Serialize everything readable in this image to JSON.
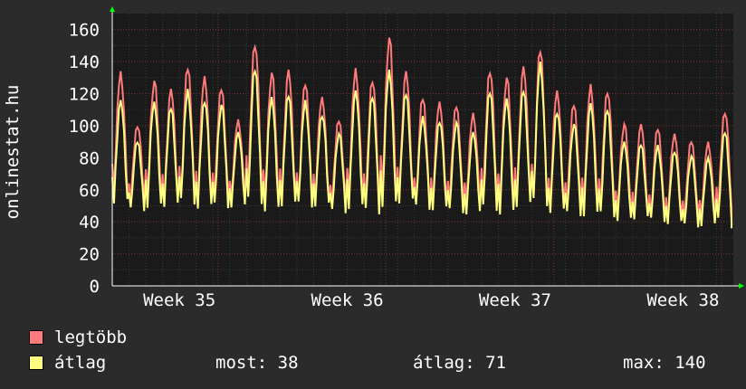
{
  "chart_data": {
    "type": "line",
    "ylabel": "onlinestat.hu",
    "ylim": [
      0,
      170
    ],
    "y_ticks": [
      "0",
      "20",
      "40",
      "60",
      "80",
      "100",
      "120",
      "140",
      "160"
    ],
    "y_tick_values": [
      0,
      20,
      40,
      60,
      80,
      100,
      120,
      140,
      160
    ],
    "x_tick_labels": [
      "Week 35",
      "Week 36",
      "Week 37",
      "Week 38"
    ],
    "x_range_days": 31,
    "x_tick_positions_days": [
      9.5,
      19.5,
      29.5,
      39.5
    ],
    "grid": true,
    "series": [
      {
        "name": "legtöbb",
        "color": "#ff7a7a",
        "daily_peaks": [
          134,
          101,
          128,
          123,
          136,
          131,
          124,
          104,
          153,
          133,
          135,
          126,
          118,
          104,
          136,
          130,
          155,
          134,
          117,
          115,
          113,
          108,
          136,
          130,
          137,
          147,
          122,
          114,
          126,
          123,
          101,
          101,
          98,
          95,
          91,
          90,
          110
        ],
        "daily_troughs": [
          45,
          44,
          43,
          41,
          42,
          40,
          42,
          45,
          43,
          40,
          40,
          41,
          44,
          41,
          40,
          38,
          42,
          42,
          41,
          42,
          40,
          41,
          40,
          38,
          40,
          38,
          38,
          38,
          36,
          37,
          37,
          36,
          35,
          34,
          33,
          34,
          36
        ]
      },
      {
        "name": "átlag",
        "color": "#ffff80",
        "daily_peaks": [
          116,
          90,
          115,
          112,
          123,
          117,
          113,
          96,
          135,
          118,
          120,
          116,
          108,
          95,
          122,
          118,
          135,
          121,
          106,
          104,
          102,
          96,
          121,
          117,
          123,
          140,
          110,
          101,
          114,
          110,
          90,
          89,
          88,
          85,
          81,
          80,
          96
        ],
        "daily_troughs": [
          42,
          41,
          40,
          38,
          39,
          37,
          39,
          42,
          40,
          37,
          37,
          38,
          40,
          38,
          37,
          35,
          38,
          39,
          38,
          38,
          37,
          37,
          37,
          35,
          36,
          35,
          35,
          35,
          33,
          34,
          34,
          33,
          32,
          31,
          30,
          31,
          32
        ]
      }
    ]
  },
  "legend": {
    "items": [
      {
        "label": "legtöbb",
        "color": "#ff7a7a"
      },
      {
        "label": "átlag",
        "color": "#ffff80"
      }
    ]
  },
  "stats": {
    "now": "most: 38",
    "avg": "átlag: 71",
    "max": "max: 140"
  },
  "colors": {
    "background": "#2b2b2b",
    "plot_background": "#1a1a1a",
    "grid_minor": "#3a3a3a",
    "grid_major": "#7a3030",
    "axis": "#ffffff",
    "arrow": "#00ff00"
  }
}
